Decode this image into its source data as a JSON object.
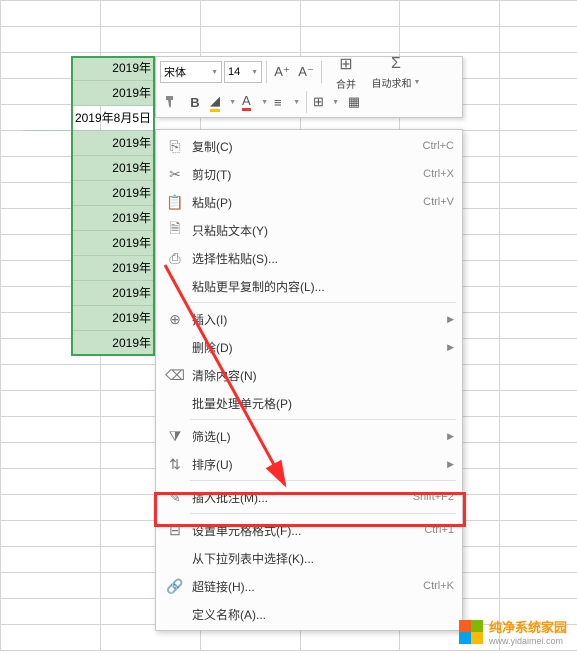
{
  "dates": [
    "2019年",
    "2019年",
    "2019年8月5日",
    "2019年",
    "2019年",
    "2019年",
    "2019年",
    "2019年",
    "2019年",
    "2019年",
    "2019年",
    "2019年"
  ],
  "toolbar": {
    "font_name": "宋体",
    "font_size": "14",
    "inc_font": "A⁺",
    "dec_font": "A⁻",
    "merge_label": "合并",
    "autosum_label": "自动求和"
  },
  "menu": {
    "copy": {
      "label": "复制(C)",
      "sc": "Ctrl+C"
    },
    "cut": {
      "label": "剪切(T)",
      "sc": "Ctrl+X"
    },
    "paste": {
      "label": "粘贴(P)",
      "sc": "Ctrl+V"
    },
    "paste_text": {
      "label": "只粘贴文本(Y)"
    },
    "paste_special": {
      "label": "选择性粘贴(S)..."
    },
    "paste_recent": {
      "label": "粘贴更早复制的内容(L)..."
    },
    "insert": {
      "label": "插入(I)"
    },
    "delete": {
      "label": "删除(D)"
    },
    "clear": {
      "label": "清除内容(N)"
    },
    "batch": {
      "label": "批量处理单元格(P)"
    },
    "filter": {
      "label": "筛选(L)"
    },
    "sort": {
      "label": "排序(U)"
    },
    "comment": {
      "label": "插入批注(M)...",
      "sc": "Shift+F2"
    },
    "format": {
      "label": "设置单元格格式(F)...",
      "sc": "Ctrl+1"
    },
    "dropdown": {
      "label": "从下拉列表中选择(K)..."
    },
    "hyperlink": {
      "label": "超链接(H)...",
      "sc": "Ctrl+K"
    },
    "define_name": {
      "label": "定义名称(A)..."
    }
  },
  "footer": {
    "brand": "纯净系统家园",
    "url": "www.yidaimei.com"
  }
}
